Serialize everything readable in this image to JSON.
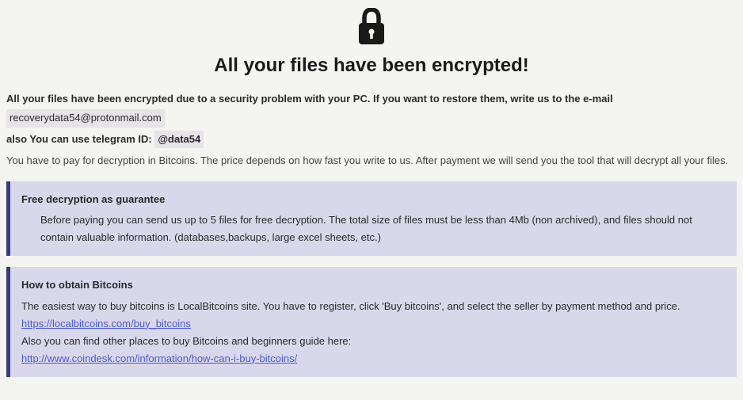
{
  "header": {
    "title": "All your files have been encrypted!"
  },
  "intro": {
    "line1": "All your files have been encrypted due to a security problem with your PC. If you want to restore them, write us to the e-mail",
    "email": "recoverydata54@protonmail.com",
    "telegram_prefix": "also You can use telegram ID: ",
    "telegram_id": "@data54",
    "payment": "You have to pay for decryption in Bitcoins. The price depends on how fast you write to us. After payment we will send you the tool that will decrypt all your files."
  },
  "panel1": {
    "title": "Free decryption as guarantee",
    "body": "Before paying you can send us up to 5 files for free decryption. The total size of files must be less than 4Mb (non archived), and files should not contain valuable information. (databases,backups, large excel sheets, etc.)"
  },
  "panel2": {
    "title": "How to obtain Bitcoins",
    "body1": "The easiest way to buy bitcoins is LocalBitcoins site. You have to register, click 'Buy bitcoins', and select the seller by payment method and price.",
    "link1": "https://localbitcoins.com/buy_bitcoins",
    "body2": "Also you can find other places to buy Bitcoins and beginners guide here:",
    "link2": "http://www.coindesk.com/information/how-can-i-buy-bitcoins/"
  }
}
